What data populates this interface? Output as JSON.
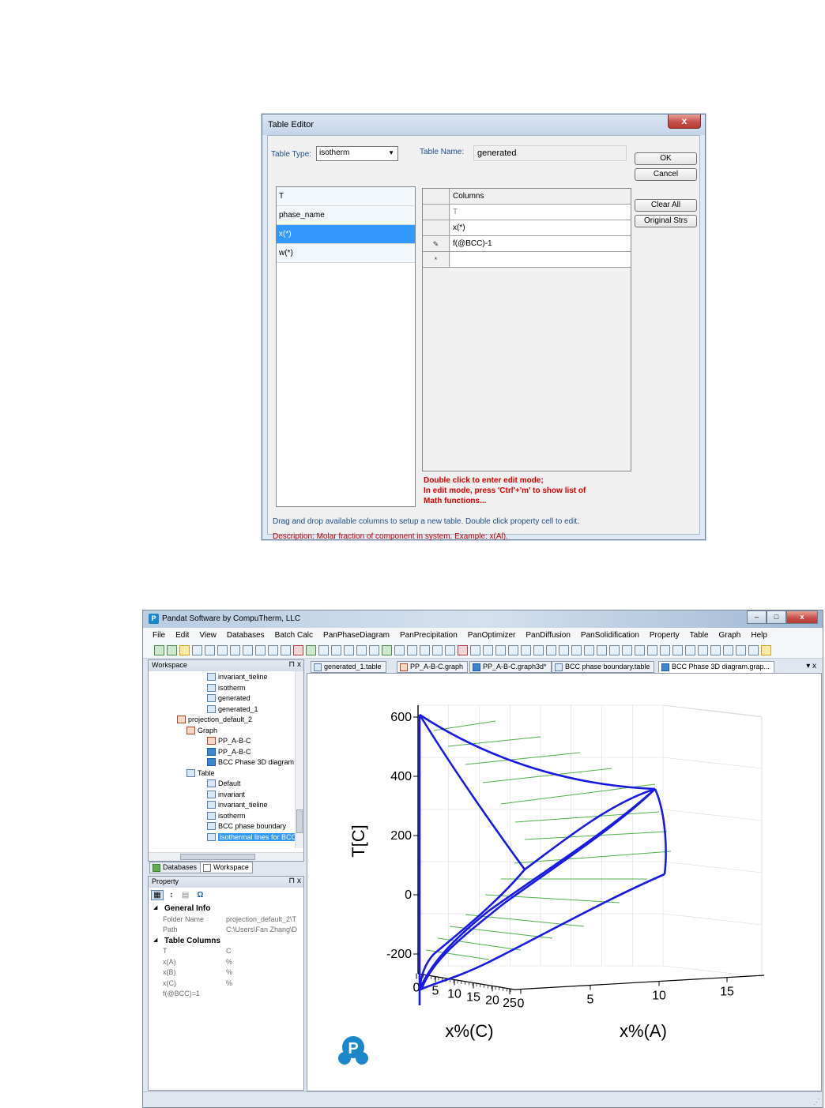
{
  "dialog": {
    "title": "Table Editor",
    "close_glyph": "x",
    "table_type_label": "Table Type:",
    "table_type_value": "isotherm",
    "table_name_label": "Table Name:",
    "table_name_value": "generated",
    "available_columns": [
      "T",
      "phase_name",
      "x(*)",
      "w(*)"
    ],
    "selected_available": "x(*)",
    "grid_header": "Columns",
    "grid_rows": [
      {
        "marker": "",
        "value": "T"
      },
      {
        "marker": "",
        "value": "x(*)"
      },
      {
        "marker": "✎",
        "value": "f(@BCC)-1"
      },
      {
        "marker": "*",
        "value": ""
      }
    ],
    "buttons": {
      "ok": "OK",
      "cancel": "Cancel",
      "clear_all": "Clear All",
      "original_strs": "Original Strs"
    },
    "edit_hint": [
      "Double click to enter edit mode;",
      "In edit mode, press 'Ctrl'+'m' to show list of",
      "Math functions..."
    ],
    "info": "Drag and drop available columns to setup a new table. Double click property cell to edit.",
    "description": "Description: Molar fraction of component in system. Example: x(Al)."
  },
  "app": {
    "title": "Pandat Software by CompuTherm, LLC",
    "logo_letter": "P",
    "window_buttons": [
      "–",
      "□",
      "x"
    ],
    "menu": [
      "File",
      "Edit",
      "View",
      "Databases",
      "Batch Calc",
      "PanPhaseDiagram",
      "PanPrecipitation",
      "PanOptimizer",
      "PanDiffusion",
      "PanSolidification",
      "Property",
      "Table",
      "Graph",
      "Help"
    ],
    "workspace": {
      "title": "Workspace",
      "pin": "⊓ x",
      "tree": [
        {
          "label": "invariant_tieline",
          "icon": "table-icon",
          "indent": 2
        },
        {
          "label": "isotherm",
          "icon": "table-icon",
          "indent": 2
        },
        {
          "label": "generated",
          "icon": "table-icon",
          "indent": 2
        },
        {
          "label": "generated_1",
          "icon": "table-icon",
          "indent": 2
        },
        {
          "label": "projection_default_2",
          "icon": "projection-icon",
          "indent": 0
        },
        {
          "label": "Graph",
          "icon": "graph-folder-icon",
          "indent": 1
        },
        {
          "label": "PP_A-B-C",
          "icon": "graph-icon",
          "indent": 2
        },
        {
          "label": "PP_A-B-C",
          "icon": "graph3d-icon",
          "indent": 2
        },
        {
          "label": "BCC Phase 3D diagram",
          "icon": "graph3d-icon",
          "indent": 2
        },
        {
          "label": "Table",
          "icon": "table-folder-icon",
          "indent": 1
        },
        {
          "label": "Default",
          "icon": "table-icon",
          "indent": 2
        },
        {
          "label": "invariant",
          "icon": "table-icon",
          "indent": 2
        },
        {
          "label": "invariant_tieline",
          "icon": "table-icon",
          "indent": 2
        },
        {
          "label": "isotherm",
          "icon": "table-icon",
          "indent": 2
        },
        {
          "label": "BCC phase boundary",
          "icon": "table-icon",
          "indent": 2
        },
        {
          "label": "isothermal lines for BCC",
          "icon": "table-icon",
          "indent": 2,
          "selected": true
        }
      ],
      "tabs": [
        "Databases",
        "Workspace"
      ]
    },
    "property": {
      "title": "Property",
      "pin": "⊓ x",
      "toolbar_glyphs": [
        "▦",
        "↕",
        "▤",
        "Ω"
      ],
      "sections": [
        {
          "name": "General Info",
          "rows": [
            {
              "key": "Folder Name",
              "value": "projection_default_2\\T"
            },
            {
              "key": "Path",
              "value": "C:\\Users\\Fan Zhang\\D"
            }
          ]
        },
        {
          "name": "Table Columns",
          "rows": [
            {
              "key": "T",
              "value": "C"
            },
            {
              "key": "x(A)",
              "value": "%"
            },
            {
              "key": "x(B)",
              "value": "%"
            },
            {
              "key": "x(C)",
              "value": "%"
            },
            {
              "key": "f(@BCC)=1",
              "value": ""
            }
          ]
        }
      ]
    },
    "doc_tabs": [
      {
        "label": "generated_1.table",
        "icon": "table-icon"
      },
      {
        "label": "PP_A-B-C.graph",
        "icon": "graph-icon"
      },
      {
        "label": "PP_A-B-C.graph3d*",
        "icon": "graph3d-icon"
      },
      {
        "label": "BCC phase boundary.table",
        "icon": "table-icon"
      },
      {
        "label": "BCC Phase 3D diagram.grap...",
        "icon": "graph3d-icon",
        "active": true
      }
    ],
    "doc_tabs_controls": "▾ x"
  },
  "chart_data": {
    "type": "3d-line",
    "zlabel": "T[C]",
    "xlabel": "x%(C)",
    "ylabel": "x%(A)",
    "z_ticks": [
      "600",
      "400",
      "200",
      "0",
      "-200"
    ],
    "x_ticks": [
      "0",
      "5",
      "10",
      "15",
      "20",
      "25"
    ],
    "y_ticks": [
      "0",
      "5",
      "10",
      "15"
    ],
    "boundary_color": "#1a1ae6",
    "tieline_color": "#52b04a",
    "logo_letter": "P"
  }
}
